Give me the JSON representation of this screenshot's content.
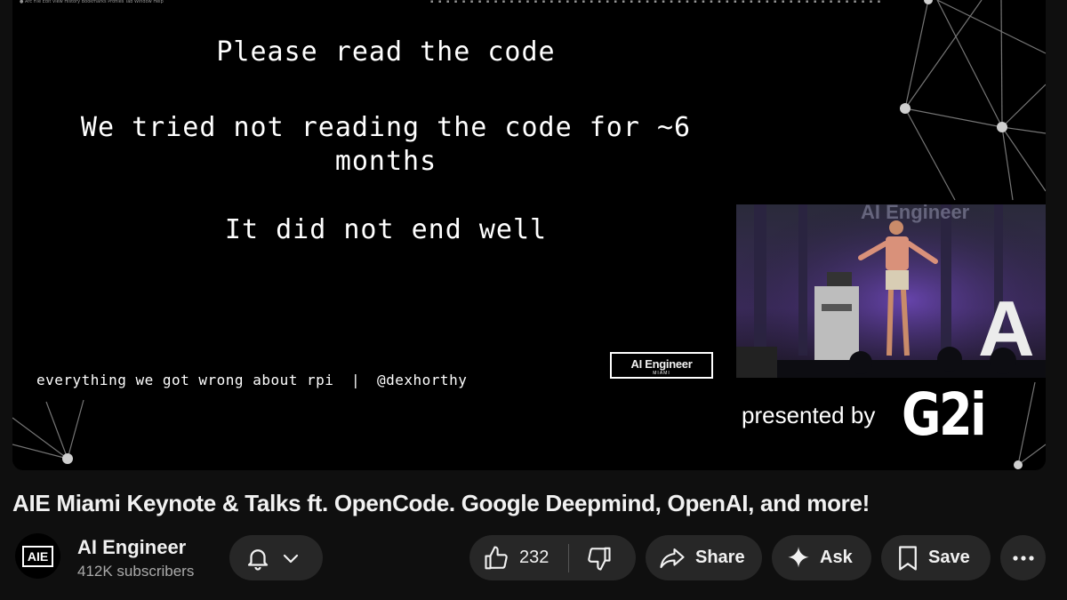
{
  "video": {
    "slide_lines": [
      "Please read the code",
      "We tried not reading the code for ~6 months",
      "It did not end well"
    ],
    "footer_left": "everything we got wrong about rpi",
    "footer_sep": "|",
    "footer_handle": "@dexhorthy",
    "logo_main": "AI Engineer",
    "logo_sub": "MIAMI",
    "pip_stage_text": "AI Engineer",
    "pip_letter": "A",
    "presented_by": "presented by",
    "sponsor": "G2i"
  },
  "title": "AIE Miami Keynote & Talks ft. OpenCode. Google Deepmind, OpenAI, and more!",
  "channel": {
    "avatar_text": "AIE",
    "name": "AI Engineer",
    "subscribers": "412K subscribers"
  },
  "actions": {
    "like_count": "232",
    "share_label": "Share",
    "ask_label": "Ask",
    "save_label": "Save"
  },
  "icons": [
    "bell-icon",
    "chevron-down-icon",
    "thumbs-up-icon",
    "thumbs-down-icon",
    "share-arrow-icon",
    "sparkle-icon",
    "bookmark-icon",
    "more-icon"
  ],
  "colors": {
    "page_bg": "#0f0f0f",
    "pill_bg": "#272727",
    "secondary_text": "#aaaaaa"
  }
}
